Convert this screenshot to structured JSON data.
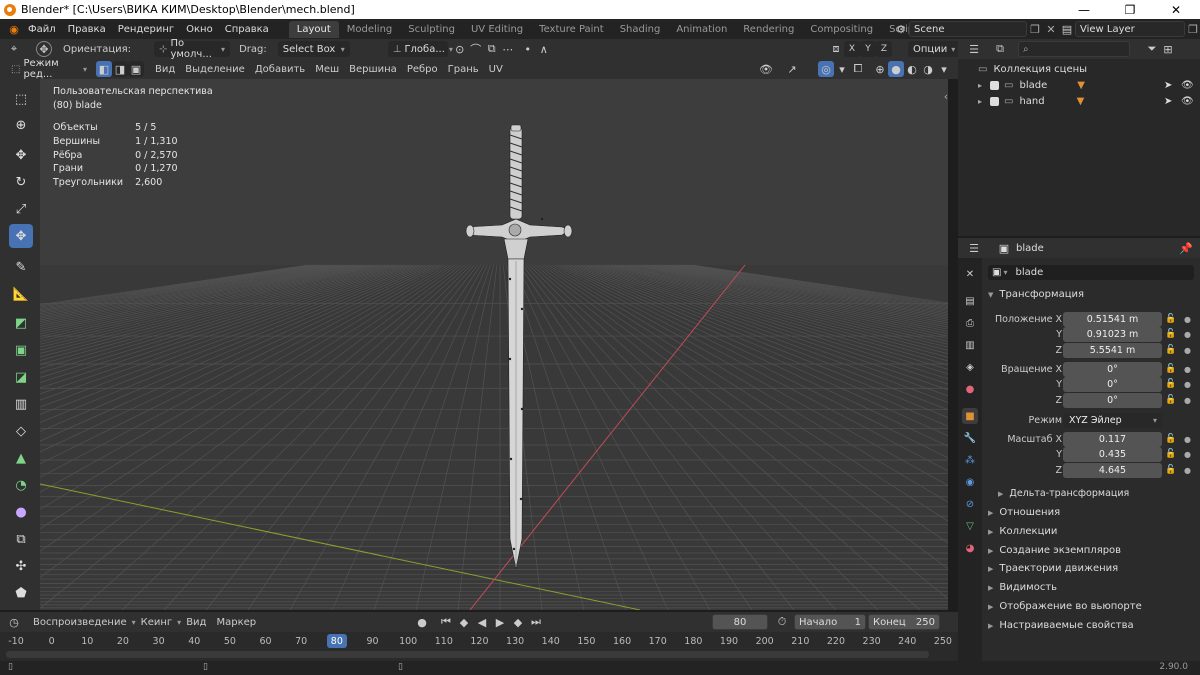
{
  "window": {
    "title": "Blender* [C:\\Users\\ВИКА КИМ\\Desktop\\Blender\\mech.blend]",
    "controls": [
      "—",
      "❐",
      "✕"
    ]
  },
  "menu": [
    "Файл",
    "Правка",
    "Рендеринг",
    "Окно",
    "Справка"
  ],
  "workspaces": [
    "Layout",
    "Modeling",
    "Sculpting",
    "UV Editing",
    "Texture Paint",
    "Shading",
    "Animation",
    "Rendering",
    "Compositing",
    "Scripting"
  ],
  "scene": {
    "name": "Scene",
    "view_layer": "View Layer"
  },
  "tool_header": {
    "orientation_label": "Ориентация:",
    "orientation_value": "По умолч...",
    "drag_label": "Drag:",
    "drag_value": "Select Box",
    "transform_value": "Глоба...",
    "options": "Опции",
    "axes": [
      "X",
      "Y",
      "Z"
    ]
  },
  "view_header": {
    "mode": "Режим ред...",
    "menus": [
      "Вид",
      "Выделение",
      "Добавить",
      "Меш",
      "Вершина",
      "Ребро",
      "Грань",
      "UV"
    ]
  },
  "overlay_info": {
    "view_name": "Пользовательская перспектива",
    "object": "(80) blade",
    "stats": [
      {
        "label": "Объекты",
        "value": "5 / 5"
      },
      {
        "label": "Вершины",
        "value": "1 / 1,310"
      },
      {
        "label": "Рёбра",
        "value": "0 / 2,570"
      },
      {
        "label": "Грани",
        "value": "0 / 1,270"
      },
      {
        "label": "Треугольники",
        "value": "2,600"
      }
    ]
  },
  "timeline": {
    "menus": [
      "Воспроизведение",
      "Кеинг",
      "Вид",
      "Маркер"
    ],
    "current_frame": "80",
    "start_label": "Начало",
    "start": "1",
    "end_label": "Конец",
    "end": "250",
    "ticks": [
      "-10",
      "0",
      "10",
      "20",
      "30",
      "40",
      "50",
      "60",
      "70",
      "80",
      "90",
      "100",
      "110",
      "120",
      "130",
      "140",
      "150",
      "160",
      "170",
      "180",
      "190",
      "200",
      "210",
      "220",
      "230",
      "240",
      "250"
    ]
  },
  "outliner": {
    "collection": "Коллекция сцены",
    "items": [
      {
        "name": "blade"
      },
      {
        "name": "hand"
      }
    ]
  },
  "properties": {
    "object_name": "blade",
    "data_name": "blade",
    "transform_title": "Трансформация",
    "location_label": "Положение X",
    "location": [
      "0.51541 m",
      "0.91023 m",
      "5.5541 m"
    ],
    "rotation_label": "Вращение X",
    "rotation": [
      "0°",
      "0°",
      "0°"
    ],
    "mode_label": "Режим",
    "mode_value": "XYZ Эйлер",
    "scale_label": "Масштаб X",
    "scale": [
      "0.117",
      "0.435",
      "4.645"
    ],
    "y_label": "Y",
    "z_label": "Z",
    "delta": "Дельта-трансформация",
    "sections": [
      "Отношения",
      "Коллекции",
      "Создание экземпляров",
      "Траектории движения",
      "Видимость",
      "Отображение во вьюпорте",
      "Настраиваемые свойства"
    ]
  },
  "status": {
    "version": "2.90.0"
  },
  "colors": {
    "accent": "#4772b3",
    "viewport": "#3d3d3d",
    "x_axis": "#c44b5a",
    "y_axis": "#8aa12e",
    "object": "#e09135"
  }
}
